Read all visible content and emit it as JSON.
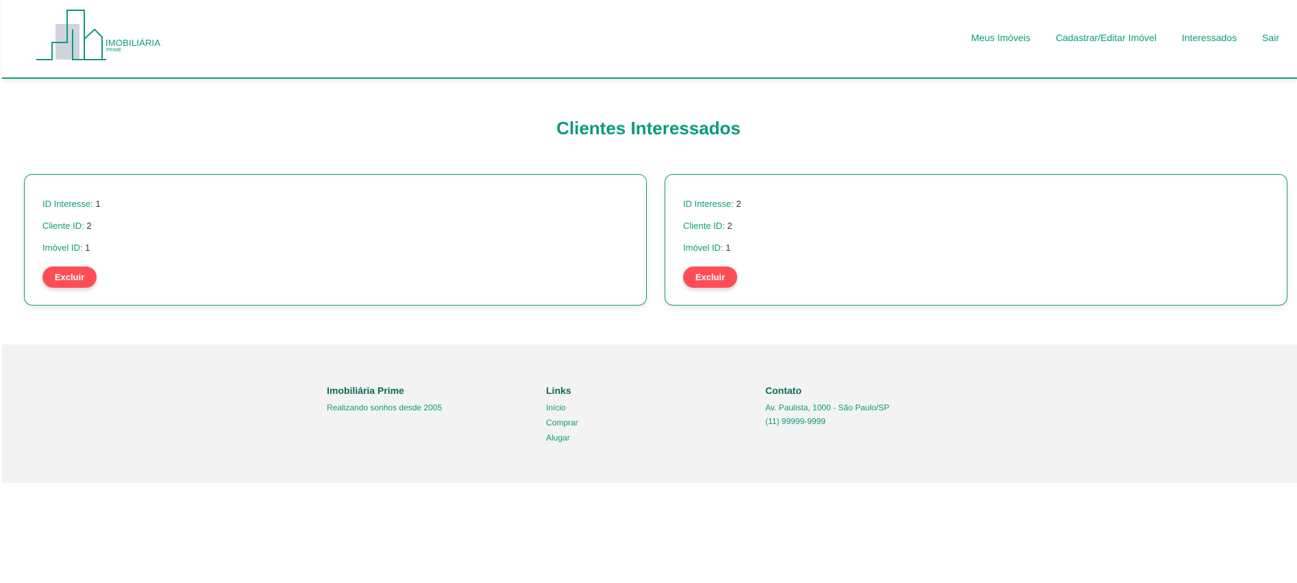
{
  "header": {
    "logo": {
      "name": "IMOBILIÁRIA",
      "sub": "PRIME"
    },
    "nav": [
      "Meus Imóveis",
      "Cadastrar/Editar Imóvel",
      "Interessados",
      "Sair"
    ]
  },
  "page_title": "Clientes Interessados",
  "cards": [
    {
      "rows": [
        {
          "label": "ID Interesse:",
          "value": "1"
        },
        {
          "label": "Cliente ID:",
          "value": "2"
        },
        {
          "label": "Imóvel ID:",
          "value": "1"
        }
      ],
      "button": "Excluir"
    },
    {
      "rows": [
        {
          "label": "ID Interesse:",
          "value": "2"
        },
        {
          "label": "Cliente ID:",
          "value": "2"
        },
        {
          "label": "Imóvel ID:",
          "value": "1"
        }
      ],
      "button": "Excluir"
    }
  ],
  "footer": {
    "about": {
      "title": "Imobiliária Prime",
      "text": "Realizando sonhos desde 2005"
    },
    "links": {
      "title": "Links",
      "items": [
        "Início",
        "Comprar",
        "Alugar"
      ]
    },
    "contact": {
      "title": "Contato",
      "address": "Av. Paulista, 1000 - São Paulo/SP",
      "phone": "(11) 99999-9999"
    }
  },
  "colors": {
    "brand": "#0b9b7a",
    "danger": "#ff4d55",
    "footer_bg": "#f3f3f3"
  }
}
